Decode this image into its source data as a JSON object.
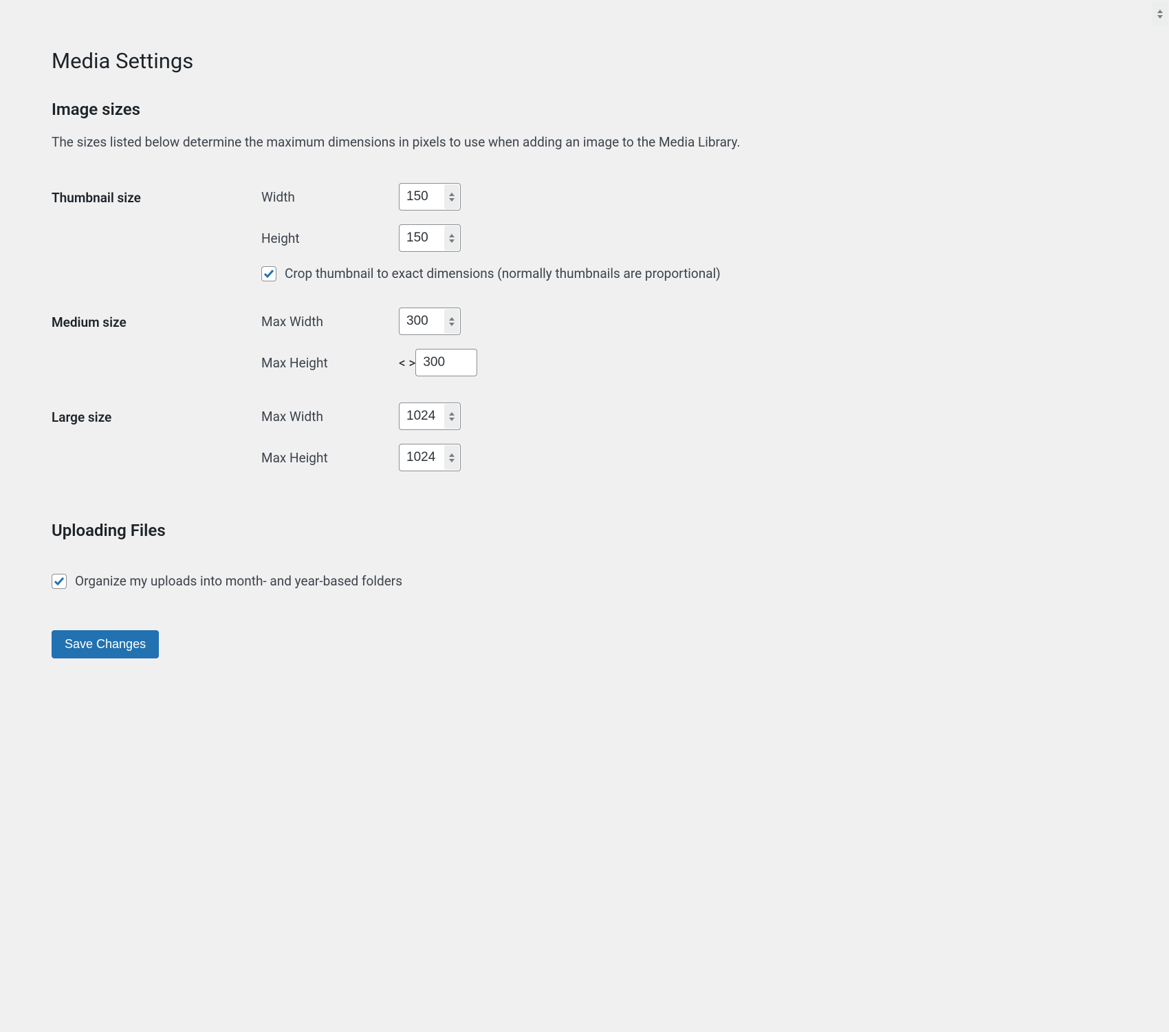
{
  "page_title": "Media Settings",
  "sections": {
    "image_sizes": {
      "heading": "Image sizes",
      "description": "The sizes listed below determine the maximum dimensions in pixels to use when adding an image to the Media Library."
    },
    "uploading": {
      "heading": "Uploading Files"
    }
  },
  "thumbnail": {
    "group_label": "Thumbnail size",
    "width_label": "Width",
    "width_value": "150",
    "height_label": "Height",
    "height_value": "150",
    "crop_checked": true,
    "crop_label": "Crop thumbnail to exact dimensions (normally thumbnails are proportional)"
  },
  "medium": {
    "group_label": "Medium size",
    "max_width_label": "Max Width",
    "max_width_value": "300",
    "max_height_label": "Max Height",
    "max_height_value": "300"
  },
  "large": {
    "group_label": "Large size",
    "max_width_label": "Max Width",
    "max_width_value": "1024",
    "max_height_label": "Max Height",
    "max_height_value": "1024"
  },
  "uploads": {
    "organize_checked": true,
    "organize_label": "Organize my uploads into month- and year-based folders"
  },
  "actions": {
    "save_label": "Save Changes"
  }
}
